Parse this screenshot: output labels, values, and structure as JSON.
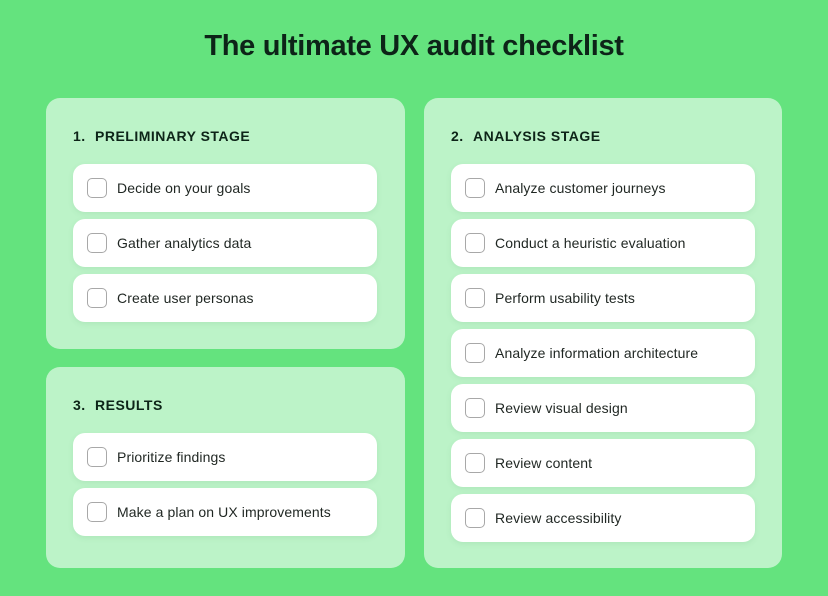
{
  "title": "The ultimate UX audit checklist",
  "colors": {
    "background": "#64e37e",
    "card": "#bcf3c8",
    "item": "#ffffff",
    "heading_text": "#0d2418",
    "checkbox_border": "#a8a8a8"
  },
  "sections": [
    {
      "number": "1.",
      "heading": "PRELIMINARY STAGE",
      "items": [
        {
          "label": "Decide on your goals",
          "checked": false
        },
        {
          "label": "Gather analytics data",
          "checked": false
        },
        {
          "label": "Create user personas",
          "checked": false
        }
      ]
    },
    {
      "number": "2.",
      "heading": "ANALYSIS STAGE",
      "items": [
        {
          "label": "Analyze customer journeys",
          "checked": false
        },
        {
          "label": "Conduct a heuristic evaluation",
          "checked": false
        },
        {
          "label": "Perform usability tests",
          "checked": false
        },
        {
          "label": "Analyze information architecture",
          "checked": false
        },
        {
          "label": "Review visual design",
          "checked": false
        },
        {
          "label": "Review content",
          "checked": false
        },
        {
          "label": "Review accessibility",
          "checked": false
        }
      ]
    },
    {
      "number": "3.",
      "heading": "RESULTS",
      "items": [
        {
          "label": "Prioritize findings",
          "checked": false
        },
        {
          "label": "Make a plan on UX improvements",
          "checked": false
        }
      ]
    }
  ]
}
